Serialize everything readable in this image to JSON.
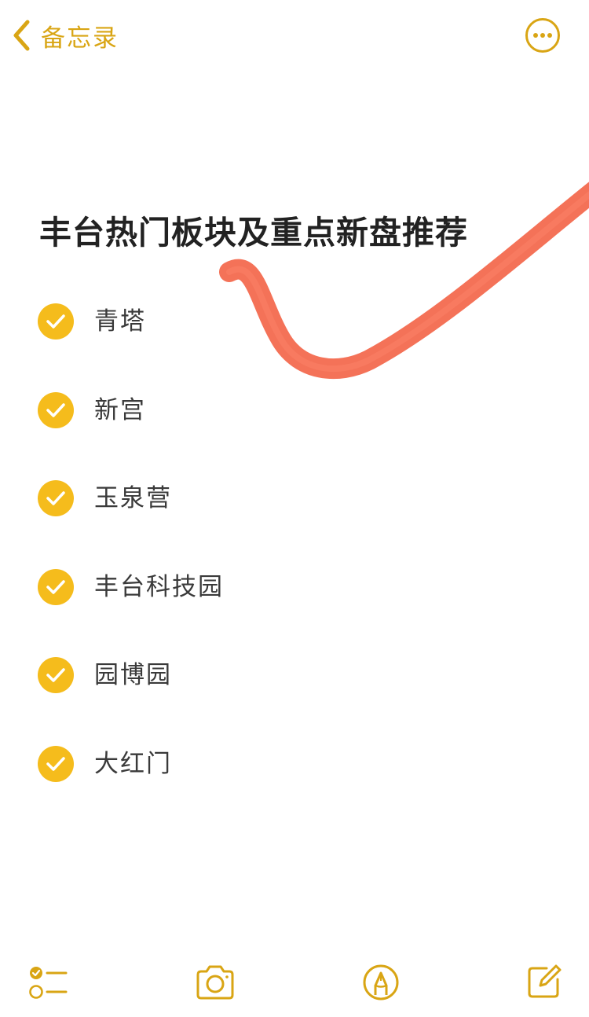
{
  "nav": {
    "back_label": "备忘录",
    "back_icon": "chevron-left-icon",
    "more_icon": "ellipsis-circle-icon"
  },
  "note": {
    "title": "丰台热门板块及重点新盘推荐",
    "items": [
      {
        "text": "青塔",
        "checked": true
      },
      {
        "text": "新宫",
        "checked": true
      },
      {
        "text": "玉泉营",
        "checked": true
      },
      {
        "text": "丰台科技园",
        "checked": true
      },
      {
        "text": "园博园",
        "checked": true
      },
      {
        "text": "大红门",
        "checked": true
      }
    ]
  },
  "toolbar": {
    "icons": [
      "checklist-icon",
      "camera-icon",
      "markup-pen-icon",
      "compose-icon"
    ]
  },
  "colors": {
    "accent": "#d9a514",
    "check_fill": "#f5bc1c",
    "ink_stroke": "#f36a4f",
    "text": "#222222"
  }
}
